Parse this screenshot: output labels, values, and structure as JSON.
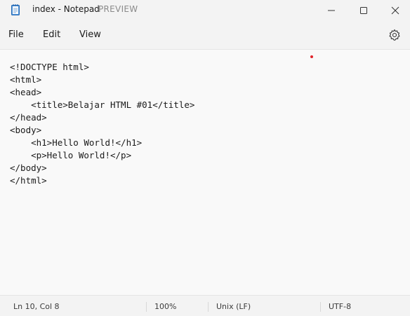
{
  "window": {
    "title": "index - Notepad",
    "preview_label": "PREVIEW",
    "icon": "notepad-icon",
    "controls": {
      "minimize_icon": "minimize-icon",
      "maximize_icon": "maximize-icon",
      "close_icon": "close-icon"
    }
  },
  "menu": {
    "items": [
      {
        "label": "File"
      },
      {
        "label": "Edit"
      },
      {
        "label": "View"
      }
    ],
    "settings_icon": "gear-icon"
  },
  "editor": {
    "lines": [
      "<!DOCTYPE html>",
      "<html>",
      "<head>",
      "    <title>Belajar HTML #01</title>",
      "</head>",
      "<body>",
      "    <h1>Hello World!</h1>",
      "    <p>Hello World!</p>",
      "</body>",
      "</html>"
    ]
  },
  "status": {
    "position": "Ln 10, Col 8",
    "zoom": "100%",
    "line_ending": "Unix (LF)",
    "encoding": "UTF-8"
  },
  "colors": {
    "cursor_marker": "#e0242b",
    "background": "#f9f9f9",
    "chrome": "#f3f3f3"
  }
}
